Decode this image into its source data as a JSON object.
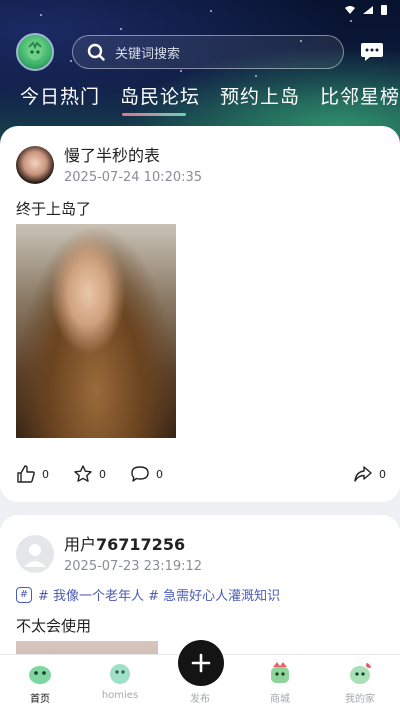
{
  "header": {
    "search_placeholder": "关键词搜索",
    "tabs": [
      {
        "label": "今日热门"
      },
      {
        "label": "岛民论坛"
      },
      {
        "label": "预约上岛"
      },
      {
        "label": "比邻星榜"
      }
    ],
    "active_tab": "岛民论坛"
  },
  "posts": [
    {
      "user": "慢了半秒的表",
      "time": "2025-07-24 10:20:35",
      "text": "终于上岛了",
      "likes": "0",
      "favorites": "0",
      "comments": "0",
      "shares": "0"
    },
    {
      "user_prefix": "用户",
      "user_number": "76717256",
      "time": "2025-07-23 23:19:12",
      "topics": "# 我像一个老年人 # 急需好心人灌溉知识",
      "text": "不太会使用"
    }
  ],
  "nav": {
    "items": [
      {
        "label": "首页",
        "icon": "home-icon"
      },
      {
        "label": "homies",
        "icon": "homies-icon"
      },
      {
        "label": "发布",
        "icon": "plus-icon"
      },
      {
        "label": "商城",
        "icon": "shop-icon"
      },
      {
        "label": "我的家",
        "icon": "profile-icon"
      }
    ],
    "active": "首页"
  },
  "colors": {
    "accent_link": "#4b5bb8",
    "hero_dark": "#07122e",
    "fab": "#141414"
  }
}
